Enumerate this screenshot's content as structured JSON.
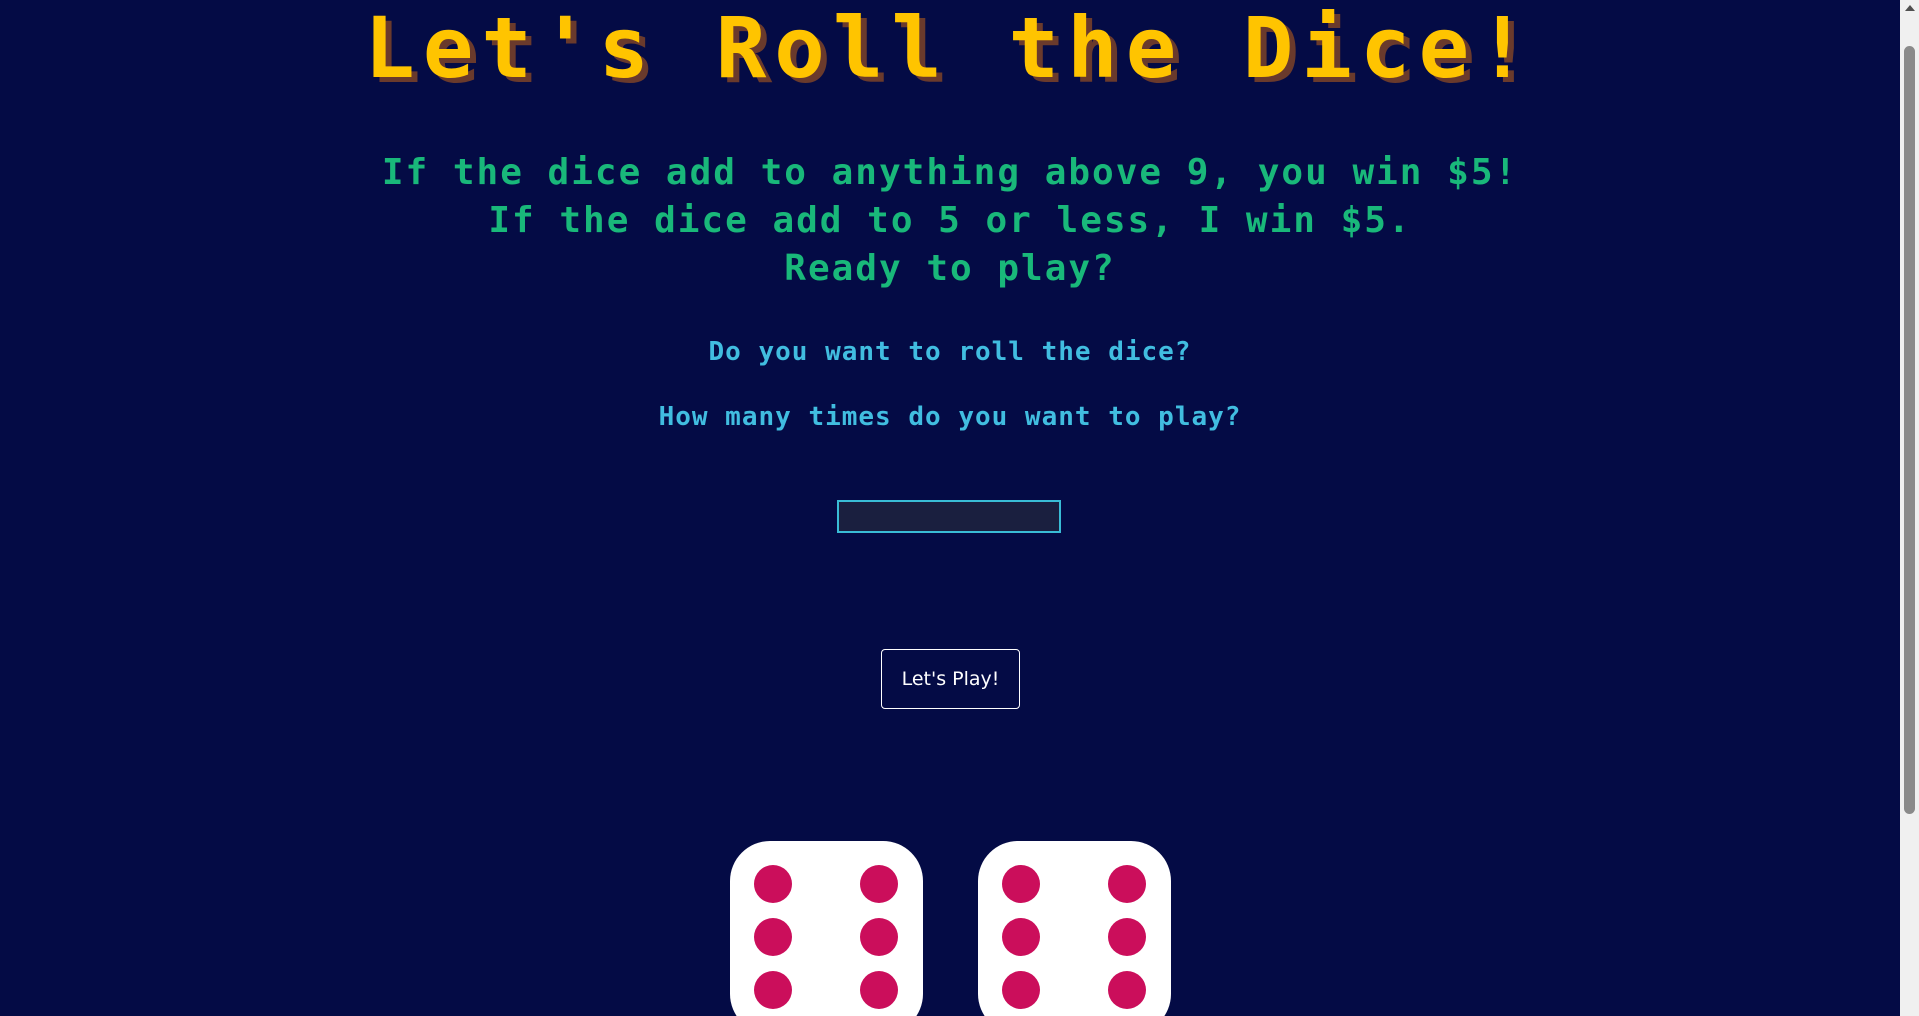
{
  "header": {
    "title": "Let's Roll the Dice!"
  },
  "rules": {
    "line1": "If the dice add to anything above 9, you win $5!",
    "line2": "If the dice add to 5 or less, I win $5.",
    "line3": "Ready to play?"
  },
  "questions": {
    "roll": "Do you want to roll the dice?",
    "times": "How many times do you want to play?"
  },
  "times_input": {
    "value": "",
    "placeholder": ""
  },
  "play_button": {
    "label": "Let's Play!"
  },
  "dice": [
    {
      "face": 6
    },
    {
      "face": 6
    }
  ],
  "colors": {
    "background": "#040b45",
    "title": "#ffc400",
    "title_shadow": "#6a3a2c",
    "rules_text": "#19b87a",
    "question_text": "#41bde0",
    "input_border": "#39bcd6",
    "pip": "#cb0e5b",
    "die_face": "#ffffff"
  },
  "icons": {
    "scroll_up": "chevron-up-icon"
  }
}
